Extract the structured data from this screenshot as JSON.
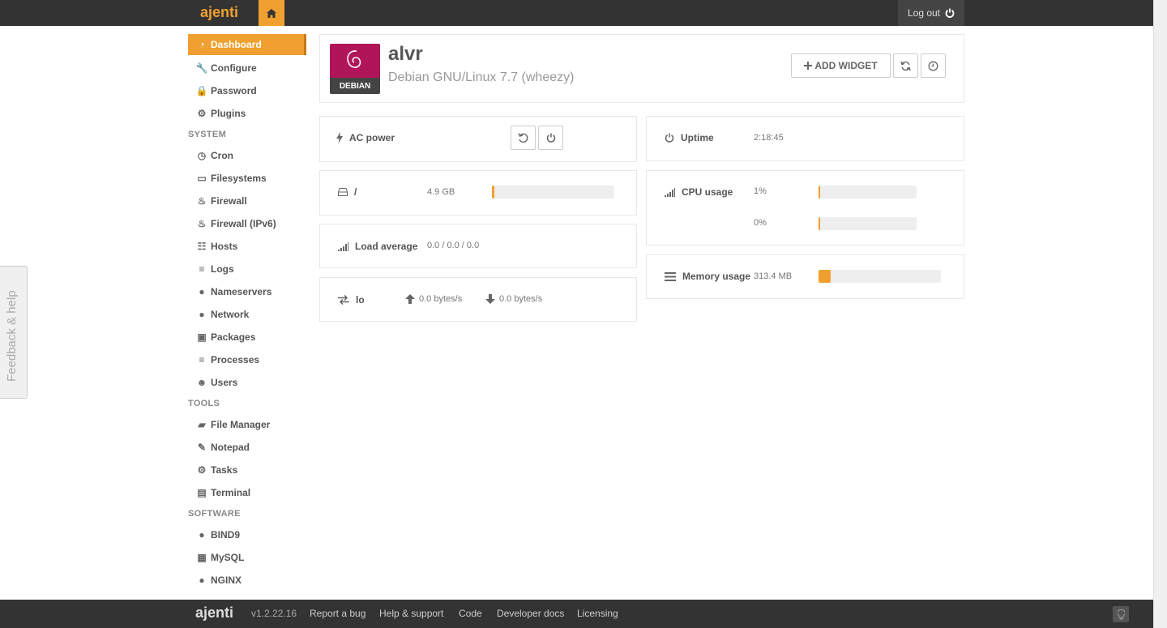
{
  "app": {
    "brand": "ajenti",
    "logout_label": "Log out"
  },
  "sidebar": {
    "top": [
      {
        "label": "Dashboard",
        "icon": "dashboard-icon"
      },
      {
        "label": "Configure",
        "icon": "wrench-icon"
      },
      {
        "label": "Password",
        "icon": "lock-icon"
      },
      {
        "label": "Plugins",
        "icon": "cogs-icon"
      }
    ],
    "system_title": "SYSTEM",
    "system": [
      {
        "label": "Cron",
        "icon": "clock-icon"
      },
      {
        "label": "Filesystems",
        "icon": "hdd-icon"
      },
      {
        "label": "Firewall",
        "icon": "fire-icon"
      },
      {
        "label": "Firewall (IPv6)",
        "icon": "fire-icon"
      },
      {
        "label": "Hosts",
        "icon": "sitemap-icon"
      },
      {
        "label": "Logs",
        "icon": "list-icon"
      },
      {
        "label": "Nameservers",
        "icon": "globe-icon"
      },
      {
        "label": "Network",
        "icon": "globe-icon"
      },
      {
        "label": "Packages",
        "icon": "gift-icon"
      },
      {
        "label": "Processes",
        "icon": "list-icon"
      },
      {
        "label": "Users",
        "icon": "group-icon"
      }
    ],
    "tools_title": "TOOLS",
    "tools": [
      {
        "label": "File Manager",
        "icon": "folder-open-icon"
      },
      {
        "label": "Notepad",
        "icon": "edit-icon"
      },
      {
        "label": "Tasks",
        "icon": "cog-icon"
      },
      {
        "label": "Terminal",
        "icon": "terminal-icon"
      }
    ],
    "software_title": "SOFTWARE",
    "software": [
      {
        "label": "BIND9",
        "icon": "globe-icon"
      },
      {
        "label": "MySQL",
        "icon": "table-icon"
      },
      {
        "label": "NGINX",
        "icon": "globe-icon"
      }
    ]
  },
  "header": {
    "hostname": "alvr",
    "os": "Debian GNU/Linux 7.7 (wheezy)",
    "logo_text": "DEBIAN",
    "add_widget_label": "ADD WIDGET"
  },
  "widgets": {
    "ac_power": {
      "label": "AC power"
    },
    "disk": {
      "label": "/",
      "value": "4.9 GB",
      "usage_fraction": 0.02
    },
    "load": {
      "label": "Load average",
      "value": "0.0 / 0.0 / 0.0"
    },
    "net": {
      "label": "lo",
      "up": "0.0 bytes/s",
      "down": "0.0 bytes/s"
    },
    "uptime": {
      "label": "Uptime",
      "value": "2:18:45"
    },
    "cpu": {
      "label": "CPU usage",
      "cores": [
        {
          "value": "1%",
          "fraction": 0.01
        },
        {
          "value": "0%",
          "fraction": 0.0
        }
      ]
    },
    "memory": {
      "label": "Memory usage",
      "value": "313.4 MB",
      "fraction": 0.1
    }
  },
  "footer": {
    "brand": "ajenti",
    "version": "v1.2.22.16",
    "links": [
      "Report a bug",
      "Help & support",
      "Code",
      "Developer docs",
      "Licensing"
    ]
  },
  "feedback_label": "Feedback & help",
  "colors": {
    "accent": "#f0a030",
    "topbar": "#333333",
    "debian": "#b0155a"
  }
}
